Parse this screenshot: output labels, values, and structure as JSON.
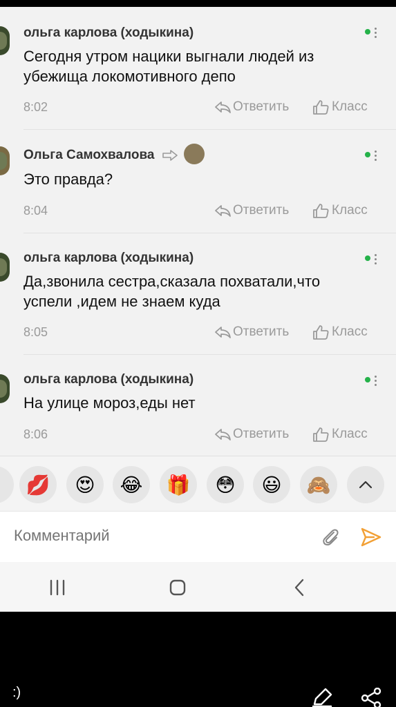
{
  "messages": [
    {
      "author": "ольга карлова (ходыкина)",
      "text": "Сегодня утром нацики выгнали людей из убежища локомотивного депо",
      "time": "8:02",
      "reply": "Ответить",
      "like": "Класс"
    },
    {
      "author": "Ольга Самохвалова",
      "text": "Это правда?",
      "time": "8:04",
      "reply": "Ответить",
      "like": "Класс"
    },
    {
      "author": "ольга карлова (ходыкина)",
      "text": "Да,звонила сестра,сказала похватали,что успели ,идем не знаем куда",
      "time": "8:05",
      "reply": "Ответить",
      "like": "Класс"
    },
    {
      "author": "ольга карлова (ходыкина)",
      "text": "На улице мороз,еды нет",
      "time": "8:06",
      "reply": "Ответить",
      "like": "Класс"
    }
  ],
  "emojis": [
    "💋",
    "😍",
    "😂",
    "🎁",
    "😳",
    "😃",
    "🙈"
  ],
  "comment": {
    "placeholder": "Комментарий"
  },
  "footer": {
    "caption": ":)"
  },
  "colors": {
    "online": "#25b24a",
    "send": "#f2a035",
    "muted": "#9a9a9a"
  },
  "icons": [
    "reply-icon",
    "like-icon",
    "attach-icon",
    "send-icon",
    "recent-apps-icon",
    "home-icon",
    "back-icon",
    "edit-icon",
    "share-icon"
  ]
}
